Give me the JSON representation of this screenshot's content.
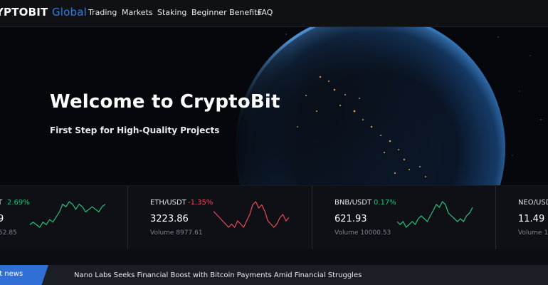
{
  "nav": {
    "logo_white": "YPTOBIT",
    "logo_blue": "Global",
    "items": [
      {
        "label": "Trading"
      },
      {
        "label": "Markets"
      },
      {
        "label": "Staking"
      },
      {
        "label": "Beginner Benefits"
      },
      {
        "label": "FAQ"
      }
    ]
  },
  "hero": {
    "title": "Welcome to CryptoBit",
    "subtitle": "First Step for High-Quality Projects"
  },
  "tickers": [
    {
      "pair": "T",
      "change": "2.69%",
      "direction": "up",
      "price": "9",
      "volume": "52.85",
      "sparkline": [
        4,
        5,
        4,
        3,
        5,
        4,
        6,
        5,
        7,
        9,
        12,
        11,
        13,
        12,
        10,
        12,
        11,
        9,
        10,
        11,
        10,
        9,
        11,
        12
      ]
    },
    {
      "pair": "ETH/USDT",
      "change": "-1.35%",
      "direction": "down",
      "price": "3223.86",
      "volume": "Volume 8977.61",
      "sparkline": [
        10,
        9,
        8,
        7,
        6,
        5,
        6,
        5,
        7,
        6,
        5,
        7,
        9,
        12,
        13,
        11,
        12,
        10,
        7,
        6,
        5,
        6,
        8,
        9,
        7,
        8
      ]
    },
    {
      "pair": "BNB/USDT",
      "change": "0.17%",
      "direction": "up",
      "price": "621.93",
      "volume": "Volume 10000.53",
      "sparkline": [
        6,
        5,
        6,
        4,
        5,
        6,
        5,
        7,
        8,
        7,
        6,
        8,
        10,
        12,
        11,
        13,
        12,
        9,
        8,
        7,
        6,
        7,
        6,
        8,
        9,
        11
      ]
    },
    {
      "pair": "NEO/USD",
      "change": "",
      "direction": "up",
      "price": "11.49",
      "volume": "Volume 1",
      "sparkline": []
    }
  ],
  "colors": {
    "accent": "#2f7de1",
    "up": "#22c37a",
    "down": "#ef4a5b",
    "news_tab": "#2f6fd6"
  },
  "news": {
    "tab_label": "st news",
    "headline": "Nano Labs Seeks Financial Boost with Bitcoin Payments Amid Financial Struggles"
  }
}
